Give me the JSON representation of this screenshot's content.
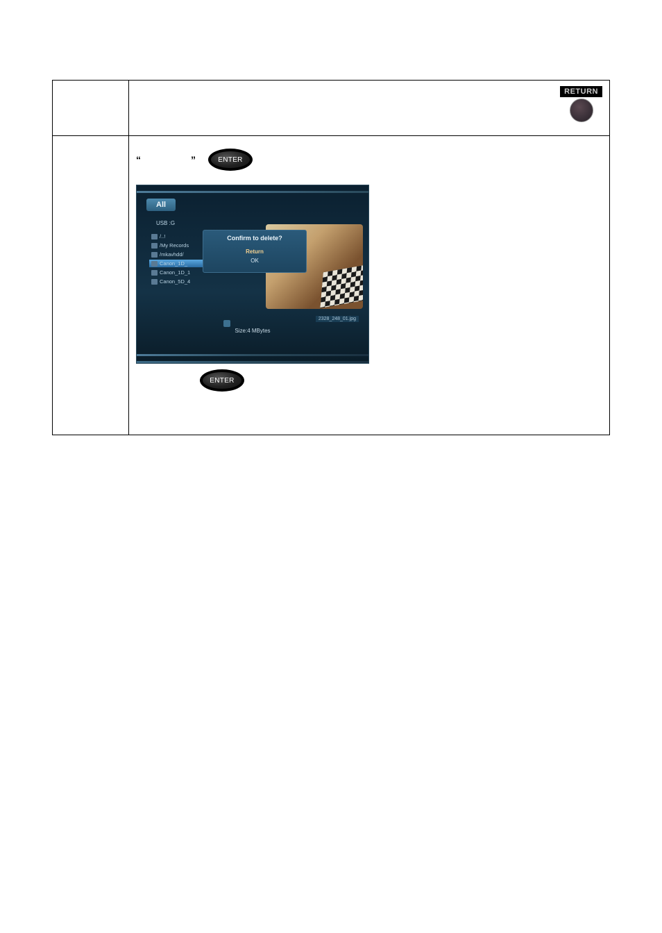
{
  "return_button": {
    "label": "RETURN"
  },
  "instruction": {
    "open_quote": "“",
    "close_quote": "”"
  },
  "enter_button": {
    "label": "ENTER"
  },
  "screenshot": {
    "tabs": {
      "active": "All",
      "others": [
        "",
        "",
        ""
      ]
    },
    "breadcrumb": "USB  :G",
    "files": [
      {
        "name": "/..!"
      },
      {
        "name": "/My Records"
      },
      {
        "name": "/mkavhdd/"
      },
      {
        "name": "Canon_1D_",
        "selected": true
      },
      {
        "name": "Canon_1D_1"
      },
      {
        "name": "Canon_5D_4"
      }
    ],
    "dialog": {
      "title": "Confirm to delete?",
      "return_btn": "Return",
      "ok_btn": "OK"
    },
    "preview_filename": "2328_248_01.jpg",
    "size_label": "Size:4 MBytes"
  }
}
